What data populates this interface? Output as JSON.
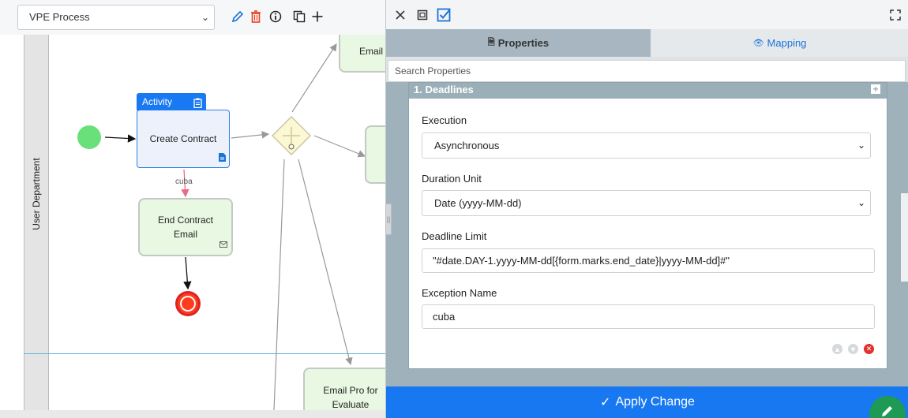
{
  "toolbar": {
    "process_select_value": "VPE Process",
    "icons": [
      "pencil-icon",
      "trash-icon",
      "info-icon",
      "copy-icon",
      "plus-icon"
    ],
    "colors": {
      "pencil": "#1a73d9",
      "trash": "#e8411e"
    }
  },
  "canvas": {
    "lane_name": "User Department",
    "activity_caption": "Activity",
    "activity_name": "Create Contract",
    "end_contract_email": "End Contract Email",
    "top_email_node": "Email",
    "email_pro_node": "Email Pro for Evaluate",
    "edge_label": "cuba"
  },
  "panel": {
    "top_icons": [
      "close-icon",
      "layout-icon",
      "checkbox-icon",
      "expand-icon"
    ],
    "tabs": [
      {
        "label": "Properties",
        "icon": "document-icon",
        "active": true
      },
      {
        "label": "Mapping",
        "icon": "eye-icon",
        "active": false
      }
    ],
    "search_placeholder": "Search Properties",
    "section": {
      "title": "1. Deadlines",
      "fields": {
        "execution_label": "Execution",
        "execution_value": "Asynchronous",
        "duration_unit_label": "Duration Unit",
        "duration_unit_value": "Date (yyyy-MM-dd)",
        "deadline_limit_label": "Deadline Limit",
        "deadline_limit_value": "\"#date.DAY-1.yyyy-MM-dd[{form.marks.end_date}|yyyy-MM-dd]#\"",
        "exception_name_label": "Exception Name",
        "exception_name_value": "cuba"
      }
    },
    "apply_label": "Apply Change",
    "colors": {
      "accent": "#1778f2",
      "fab": "#1e9a55",
      "section_head": "#9bafb9"
    }
  }
}
